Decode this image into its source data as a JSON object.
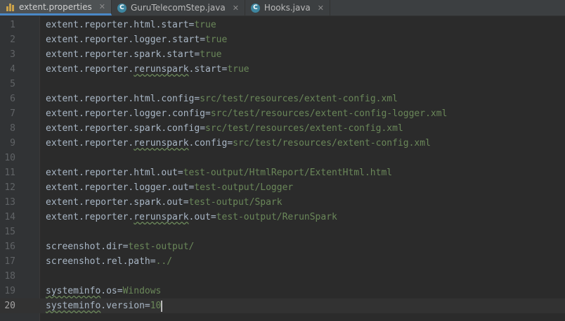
{
  "tabs": [
    {
      "label": "extent.properties",
      "icon": "properties-file-icon",
      "active": true
    },
    {
      "label": "GuruTelecomStep.java",
      "icon": "java-class-icon",
      "active": false
    },
    {
      "label": "Hooks.java",
      "icon": "java-class-icon",
      "active": false
    }
  ],
  "lines": [
    {
      "n": "1",
      "key": "extent.reporter.html.start",
      "value": "true"
    },
    {
      "n": "2",
      "key": "extent.reporter.logger.start",
      "value": "true"
    },
    {
      "n": "3",
      "key": "extent.reporter.spark.start",
      "value": "true"
    },
    {
      "n": "4",
      "key": "extent.reporter.rerunspark.start",
      "value": "true"
    },
    {
      "n": "5",
      "key": "",
      "value": ""
    },
    {
      "n": "6",
      "key": "extent.reporter.html.config",
      "value": "src/test/resources/extent-config.xml"
    },
    {
      "n": "7",
      "key": "extent.reporter.logger.config",
      "value": "src/test/resources/extent-config-logger.xml"
    },
    {
      "n": "8",
      "key": "extent.reporter.spark.config",
      "value": "src/test/resources/extent-config.xml"
    },
    {
      "n": "9",
      "key": "extent.reporter.rerunspark.config",
      "value": "src/test/resources/extent-config.xml"
    },
    {
      "n": "10",
      "key": "",
      "value": ""
    },
    {
      "n": "11",
      "key": "extent.reporter.html.out",
      "value": "test-output/HtmlReport/ExtentHtml.html"
    },
    {
      "n": "12",
      "key": "extent.reporter.logger.out",
      "value": "test-output/Logger"
    },
    {
      "n": "13",
      "key": "extent.reporter.spark.out",
      "value": "test-output/Spark"
    },
    {
      "n": "14",
      "key": "extent.reporter.rerunspark.out",
      "value": "test-output/RerunSpark"
    },
    {
      "n": "15",
      "key": "",
      "value": ""
    },
    {
      "n": "16",
      "key": "screenshot.dir",
      "value": "test-output/"
    },
    {
      "n": "17",
      "key": "screenshot.rel.path",
      "value": "../"
    },
    {
      "n": "18",
      "key": "",
      "value": ""
    },
    {
      "n": "19",
      "key": "systeminfo.os",
      "value": "Windows"
    },
    {
      "n": "20",
      "key": "systeminfo.version",
      "value": "10"
    }
  ],
  "current_line": "20",
  "colors": {
    "key": "#a9b7c6",
    "value": "#6a8759",
    "background": "#2b2b2b",
    "gutter": "#313335"
  }
}
